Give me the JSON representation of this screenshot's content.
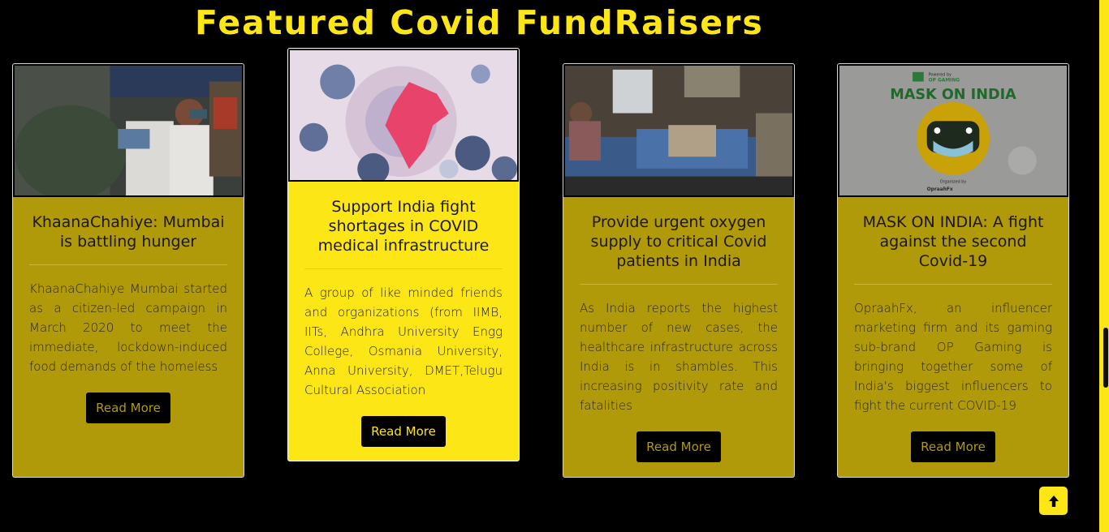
{
  "section": {
    "title": "Featured Covid FundRaisers"
  },
  "cards": [
    {
      "image_icon": "street-food-distribution-photo",
      "title": "KhaanaChahiye: Mumbai is battling hunger",
      "text": "KhaanaChahiye Mumbai started as a citizen-led campaign in March 2020 to meet the immediate, lockdown-induced food demands of the homeless",
      "button": "Read More"
    },
    {
      "image_icon": "covid-virus-india-map-image",
      "title": "Support India fight shortages in COVID medical infrastructure",
      "text": "A group of like minded friends and organizations (from IIMB, IITs, Andhra University Engg College, Osmania University, Anna University, DMET,Telugu Cultural Association",
      "button": "Read More"
    },
    {
      "image_icon": "hospital-patient-photo",
      "title": "Provide urgent oxygen supply to critical Covid patients in India",
      "text": "As India reports the highest number of new cases, the healthcare infrastructure across India is in shambles. This increasing positivity rate and fatalities",
      "button": "Read More"
    },
    {
      "image_icon": "mask-on-india-poster",
      "image_text": {
        "powered": "Powered by",
        "brand": "OP GAMING",
        "headline": "MASK ON INDIA",
        "organized": "Organized by",
        "org": "OpraahFx"
      },
      "title": "MASK ON INDIA: A fight against the second Covid-19",
      "text": "OpraahFx, an influencer marketing firm and its gaming sub-brand OP Gaming is bringing together some of India's biggest influencers to fight the current COVID-19",
      "button": "Read More"
    }
  ],
  "scroll_top": {
    "icon": "arrow-up-icon"
  },
  "colors": {
    "accent": "#fde616",
    "card_dim": "#b09a0a",
    "background": "#000000"
  }
}
